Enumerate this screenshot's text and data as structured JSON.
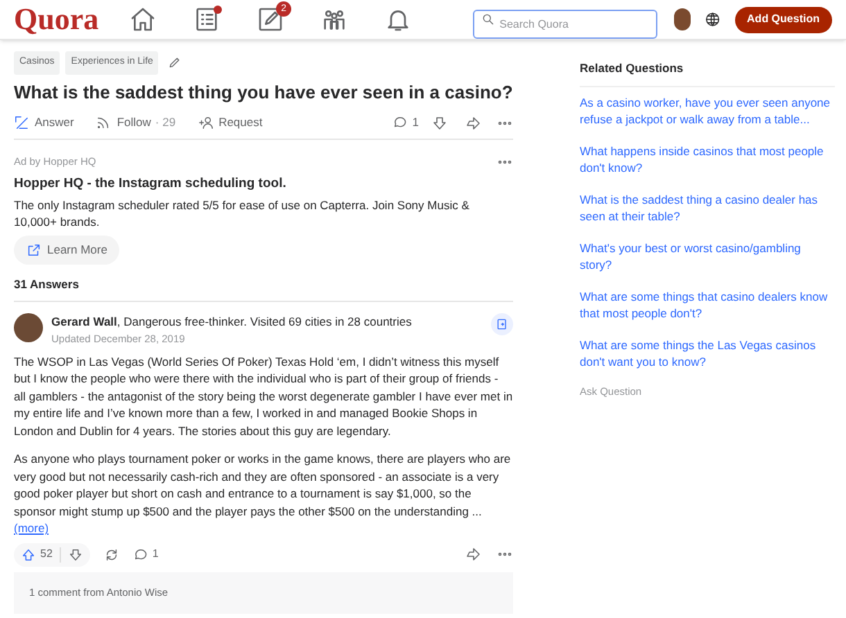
{
  "header": {
    "logo": "Quora",
    "nav": [
      {
        "kind": "home",
        "dot": false
      },
      {
        "kind": "feed",
        "dot": true
      },
      {
        "kind": "write",
        "dot": false,
        "badge": "2"
      },
      {
        "kind": "spaces",
        "dot": false
      },
      {
        "kind": "bell",
        "dot": false
      }
    ],
    "search": {
      "placeholder": "Search Quora"
    },
    "add_question": "Add Question"
  },
  "question": {
    "topics": [
      "Casinos",
      "Experiences in Life"
    ],
    "title": "What is the saddest thing you have ever seen in a casino?",
    "answer": "Answer",
    "follow": "Follow",
    "follow_count": "· 29",
    "request": "Request",
    "comments": "1"
  },
  "ad": {
    "label": "Ad by Hopper HQ",
    "title": "Hopper HQ - the Instagram scheduling tool.",
    "body": "The only Instagram scheduler rated 5/5 for ease of use on Capterra. Join Sony Music & 10,000+ brands.",
    "button": "Learn More"
  },
  "answers_count": "31 Answers",
  "answer": {
    "author": "Gerard Wall",
    "credential": ", Dangerous free-thinker. Visited 69 cities in 28 countries",
    "date": "Updated December 28, 2019",
    "paragraphs": [
      "The WSOP in Las Vegas (World Series Of Poker) Texas Hold ‘em, I didn’t witness this myself but I know the people who were there with the individual who is part of their group of friends - all gamblers - the antagonist of the story being the worst degenerate gambler I have ever met in my entire life and I’ve known more than a few, I worked in and managed Bookie Shops in London and Dublin for 4 years. The stories about this guy are legendary.",
      "As anyone who plays tournament poker or works in the game knows, there are players who are very good but not necessarily cash-rich and they are often sponsored - an associate is a very good poker player but short on cash and entrance to a tournament is say $1,000, so the sponsor might stump up $500 and the player pays the other $500 on the understanding ..."
    ],
    "more": "(more)",
    "upvotes": "52",
    "comments": "1",
    "comment_preview": "1 comment from Antonio Wise"
  },
  "related": {
    "heading": "Related Questions",
    "items": [
      "As a casino worker, have you ever seen anyone refuse a jackpot or walk away from a table...",
      "What happens inside casinos that most people don't know?",
      "What is the saddest thing a casino dealer has seen at their table?",
      "What's your best or worst casino/gambling story?",
      "What are some things that casino dealers know that most people don't?",
      "What are some things the Las Vegas casinos don't want you to know?"
    ],
    "ask": "Ask Question"
  }
}
